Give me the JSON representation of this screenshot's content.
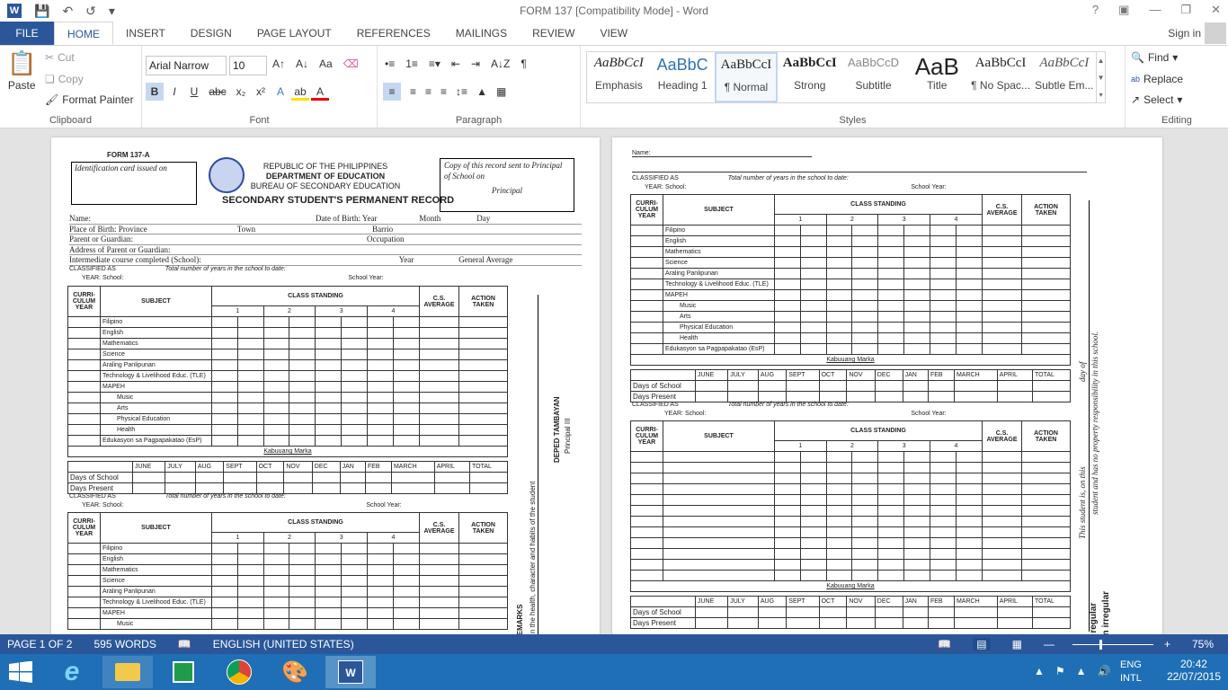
{
  "window": {
    "title": "FORM 137 [Compatibility Mode] - Word",
    "help": "?"
  },
  "tabs": [
    "FILE",
    "HOME",
    "INSERT",
    "DESIGN",
    "PAGE LAYOUT",
    "REFERENCES",
    "MAILINGS",
    "REVIEW",
    "VIEW"
  ],
  "account": {
    "sign_in": "Sign in"
  },
  "clipboard": {
    "paste": "Paste",
    "cut": "Cut",
    "copy": "Copy",
    "format_painter": "Format Painter",
    "label": "Clipboard"
  },
  "font": {
    "family": "Arial Narrow",
    "size": "10",
    "label": "Font",
    "bold": "B",
    "italic": "I",
    "underline": "U",
    "strike": "abc"
  },
  "paragraph": {
    "label": "Paragraph"
  },
  "styles": {
    "label": "Styles",
    "items": [
      {
        "preview": "AaBbCcI",
        "name": "Emphasis"
      },
      {
        "preview": "AaBbC",
        "name": "Heading 1"
      },
      {
        "preview": "AaBbCcI",
        "name": "¶ Normal"
      },
      {
        "preview": "AaBbCcI",
        "name": "Strong"
      },
      {
        "preview": "AaBbCcD",
        "name": "Subtitle"
      },
      {
        "preview": "AaB",
        "name": "Title"
      },
      {
        "preview": "AaBbCcI",
        "name": "¶ No Spac..."
      },
      {
        "preview": "AaBbCcI",
        "name": "Subtle Em..."
      }
    ]
  },
  "editing": {
    "find": "Find",
    "replace": "Replace",
    "select": "Select",
    "label": "Editing"
  },
  "doc_left": {
    "form_no": "FORM 137-A",
    "id_card": "Identification card issued on",
    "republic": "REPUBLIC OF THE PHILIPPINES",
    "dept": "DEPARTMENT OF EDUCATION",
    "bureau": "BUREAU OF SECONDARY EDUCATION",
    "record": "SECONDARY STUDENT'S PERMANENT RECORD",
    "copy_sent": "Copy of this record sent to Principal of School on",
    "principal": "Principal",
    "fields": [
      "Name:",
      "Place of Birth: Province",
      "Parent or Guardian:",
      "Address of Parent or Guardian:",
      "Intermediate course completed (School):"
    ],
    "birth": "Date of Birth: Year",
    "month": "Month",
    "day": "Day",
    "town": "Town",
    "barrio": "Barrio",
    "occupation": "Occupation",
    "year": "Year",
    "gen_avg": "General Average",
    "classified": "CLASSIFIED AS",
    "total_years": "Total number of years in the school to date:",
    "year_school": "YEAR: School:",
    "school_year": "School Year:",
    "remarks": "REMARKS",
    "deped": "DEPED TAMBAYAN",
    "principal3": "Principal III",
    "health": "n the health, character and habits of the student"
  },
  "table_head": {
    "curr": "CURRI-CULUM YEAR",
    "subject": "SUBJECT",
    "class": "CLASS STANDING",
    "cs": "C.S. AVERAGE",
    "action": "ACTION TAKEN",
    "q": [
      "1",
      "2",
      "3",
      "4"
    ]
  },
  "subjects": [
    "Filipino",
    "English",
    "Mathematics",
    "Science",
    "Araling Panlipunan",
    "Technology & Livelihood Educ. (TLE)",
    "MAPEH",
    "Music",
    "Arts",
    "Physical Education",
    "Health",
    "Edukasyon sa Pagpapakatao (EsP)"
  ],
  "kabuuang": "Kabuuang Marka",
  "months": [
    "JUNE",
    "JULY",
    "AUG",
    "SEPT",
    "OCT",
    "NOV",
    "DEC",
    "JAN",
    "FEB",
    "MARCH",
    "APRIL",
    "TOTAL"
  ],
  "days": [
    "Days of School",
    "Days Present"
  ],
  "doc_right": {
    "name": "Name:",
    "side1": "This student is, on this",
    "side2": "day of",
    "side3": "student and has no property responsibility in this school.",
    "regular": "a regular",
    "irregular": "an irregular"
  },
  "status": {
    "page": "PAGE 1 OF 2",
    "words": "595 WORDS",
    "lang": "ENGLISH (UNITED STATES)",
    "zoom": "75%"
  },
  "tray": {
    "lang1": "ENG",
    "lang2": "INTL",
    "time": "20:42",
    "date": "22/07/2015"
  }
}
